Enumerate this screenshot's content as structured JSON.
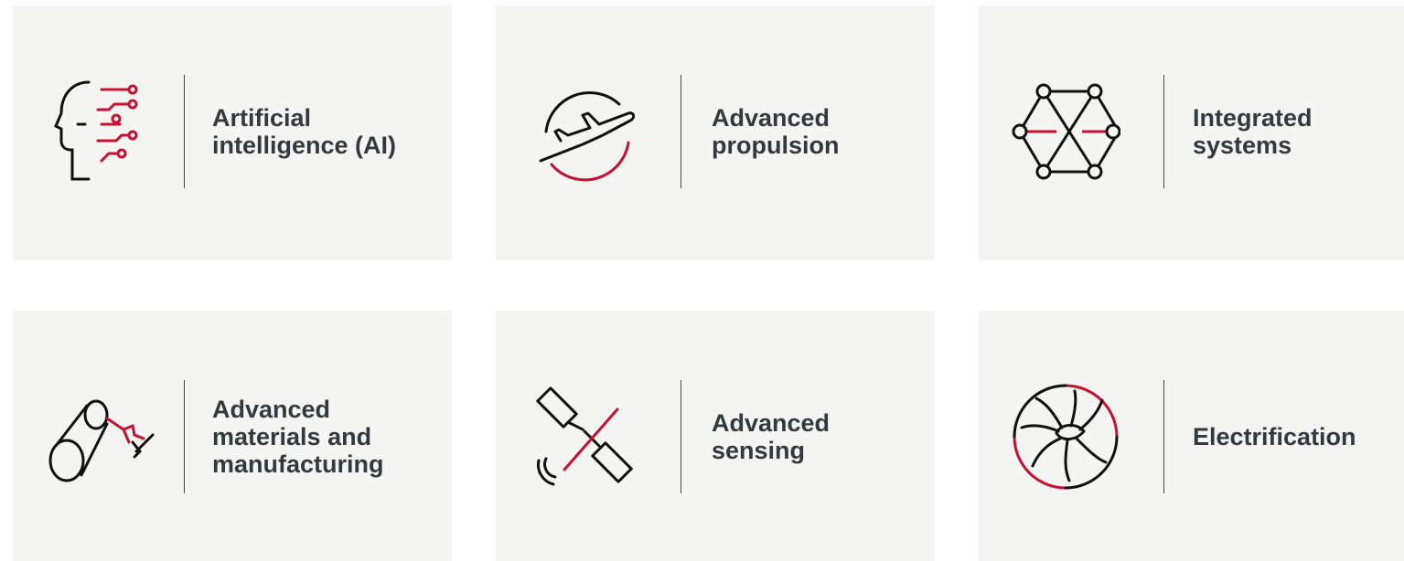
{
  "colors": {
    "tile_background": "#f4f4f3",
    "icon_dark": "#111111",
    "icon_accent": "#c8102e",
    "label_text": "#333a3f",
    "divider": "#4a4a4a"
  },
  "tiles": [
    {
      "label": "Artificial\nintelligence (AI)",
      "icon": "ai-head-icon"
    },
    {
      "label": "Advanced\npropulsion",
      "icon": "airplane-icon"
    },
    {
      "label": "Integrated\nsystems",
      "icon": "network-hexagon-icon"
    },
    {
      "label": "Advanced\nmaterials and\nmanufacturing",
      "icon": "robotic-arm-icon"
    },
    {
      "label": "Advanced\nsensing",
      "icon": "satellite-icon"
    },
    {
      "label": "Electrification",
      "icon": "turbine-fan-icon"
    }
  ]
}
